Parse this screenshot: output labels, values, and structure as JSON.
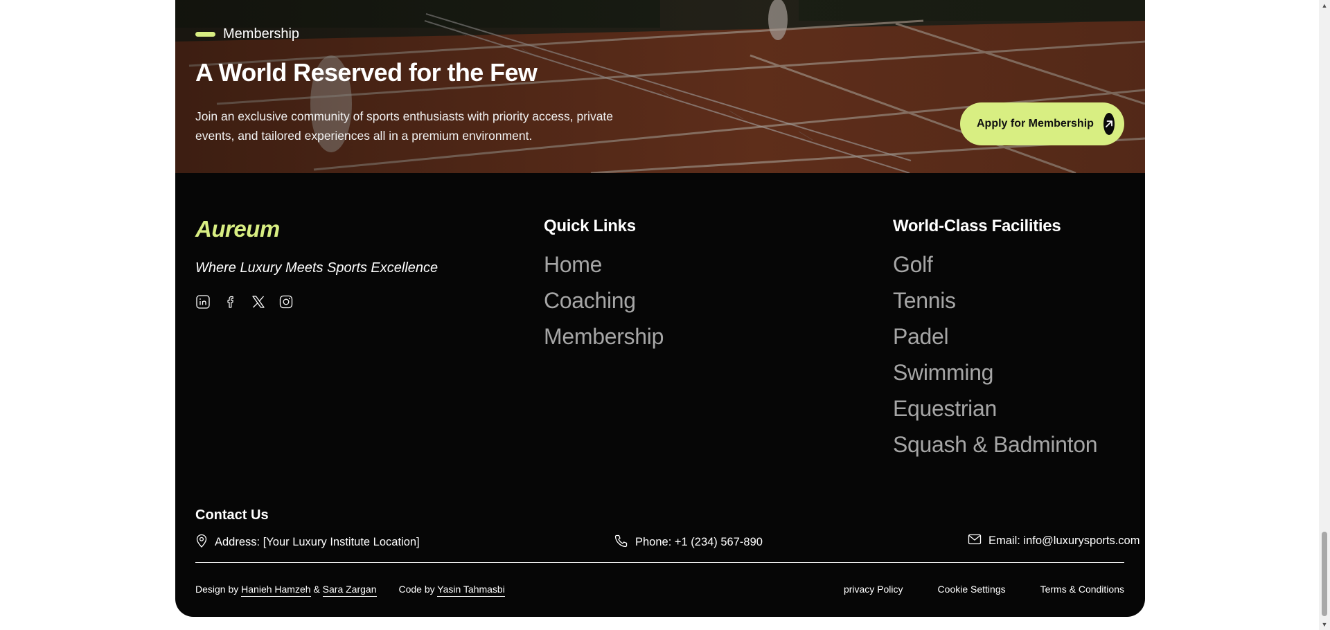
{
  "colors": {
    "accent": "#d8ee82",
    "background": "#060606",
    "muted_link": "#a6a6a6",
    "text": "#ffffff"
  },
  "hero": {
    "kicker": "Membership",
    "title": "A World Reserved for the Few",
    "description": "Join an exclusive community of sports enthusiasts with priority access, private events, and tailored experiences all in a premium environment.",
    "cta_label": "Apply for Membership",
    "cta_icon": "arrow-up-right-icon"
  },
  "footer": {
    "brand": "Aureum",
    "tagline": "Where Luxury Meets Sports Excellence",
    "socials": [
      "linkedin-icon",
      "facebook-icon",
      "x-icon",
      "instagram-icon"
    ],
    "quick_links": {
      "title": "Quick Links",
      "items": [
        "Home",
        "Coaching",
        "Membership"
      ]
    },
    "facilities": {
      "title": "World-Class Facilities",
      "items": [
        "Golf",
        "Tennis",
        "Padel",
        "Swimming",
        "Equestrian",
        "Squash & Badminton"
      ]
    },
    "contact": {
      "title": "Contact Us",
      "address": "Address: [Your Luxury Institute Location]",
      "phone": "Phone: +1 (234) 567-890",
      "email": "Email: info@luxurysports.com"
    },
    "credits": {
      "design_prefix": "Design by",
      "designer1": "Hanieh Hamzeh",
      "amp": "&",
      "designer2": "Sara Zargan",
      "code_prefix": "Code by",
      "coder": "Yasin Tahmasbi"
    },
    "legal": {
      "privacy": "privacy Policy",
      "cookies": "Cookie Settings",
      "terms": "Terms & Conditions"
    }
  }
}
